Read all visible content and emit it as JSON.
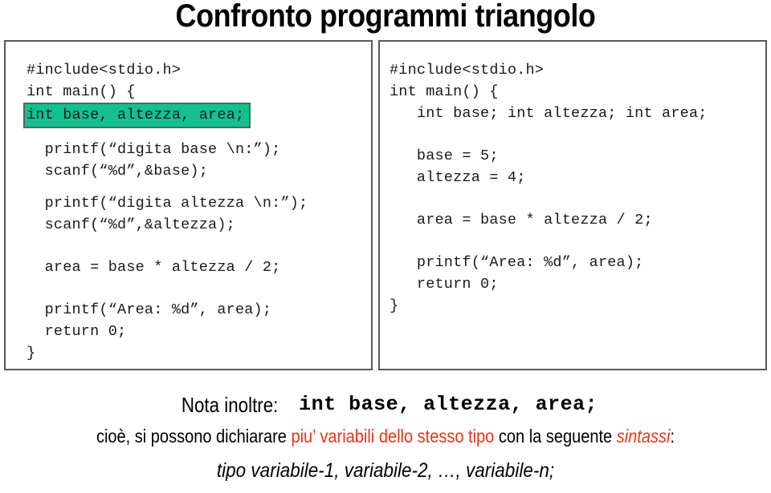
{
  "slide": {
    "title": "Confronto programmi triangolo"
  },
  "colors": {
    "highlight_green": "#14c08e",
    "highlight_border": "#4c6b63",
    "accent_red": "#e2371c",
    "panel_border": "#58585a",
    "text": "#000000"
  },
  "left_program": {
    "lines": [
      {
        "text": "#include<stdio.h>",
        "highlighted": false,
        "blank": false
      },
      {
        "text": "int main() {",
        "highlighted": false,
        "blank": false
      },
      {
        "text": "int base, altezza, area;",
        "highlighted": true,
        "blank": false
      },
      {
        "text": "",
        "highlighted": false,
        "blank": true
      },
      {
        "text": "  printf(“digita base \\n:”);",
        "highlighted": false,
        "blank": false
      },
      {
        "text": "  scanf(“%d”,&base);",
        "highlighted": false,
        "blank": false
      },
      {
        "text": "",
        "highlighted": false,
        "blank": true
      },
      {
        "text": "  printf(“digita altezza \\n:”);",
        "highlighted": false,
        "blank": false
      },
      {
        "text": "  scanf(“%d”,&altezza);",
        "highlighted": false,
        "blank": false
      },
      {
        "text": "",
        "highlighted": false,
        "blank": true
      },
      {
        "text": "",
        "highlighted": false,
        "blank": true
      },
      {
        "text": "  area = base * altezza / 2;",
        "highlighted": false,
        "blank": false
      },
      {
        "text": "",
        "highlighted": false,
        "blank": true
      },
      {
        "text": "",
        "highlighted": false,
        "blank": true
      },
      {
        "text": "  printf(“Area: %d”, area);",
        "highlighted": false,
        "blank": false
      },
      {
        "text": "  return 0;",
        "highlighted": false,
        "blank": false
      },
      {
        "text": "}",
        "highlighted": false,
        "blank": false
      }
    ]
  },
  "right_program": {
    "lines": [
      {
        "text": "#include<stdio.h>",
        "highlighted": false,
        "blank": false
      },
      {
        "text": "int main() {",
        "highlighted": false,
        "blank": false
      },
      {
        "text": "   int base; int altezza; int area;",
        "highlighted": false,
        "blank": false
      },
      {
        "text": "",
        "highlighted": false,
        "blank": true
      },
      {
        "text": "",
        "highlighted": false,
        "blank": true
      },
      {
        "text": "   base = 5;",
        "highlighted": false,
        "blank": false
      },
      {
        "text": "   altezza = 4;",
        "highlighted": false,
        "blank": false
      },
      {
        "text": "",
        "highlighted": false,
        "blank": true
      },
      {
        "text": "",
        "highlighted": false,
        "blank": true
      },
      {
        "text": "   area = base * altezza / 2;",
        "highlighted": false,
        "blank": false
      },
      {
        "text": "",
        "highlighted": false,
        "blank": true
      },
      {
        "text": "",
        "highlighted": false,
        "blank": true
      },
      {
        "text": "   printf(“Area: %d”, area);",
        "highlighted": false,
        "blank": false
      },
      {
        "text": "   return 0;",
        "highlighted": false,
        "blank": false
      },
      {
        "text": "}",
        "highlighted": false,
        "blank": false
      }
    ]
  },
  "note": {
    "label": "Nota inoltre:",
    "code": "int base, altezza, area;",
    "line2_part1": "cioè, si possono dichiarare ",
    "line2_accent": "piu’ variabili dello stesso tipo",
    "line2_part2": " con la seguente ",
    "line2_accent_italic": "sintassi",
    "line2_part3": ":",
    "line3": "tipo variabile-1, variabile-2, …, variabile-n;"
  }
}
